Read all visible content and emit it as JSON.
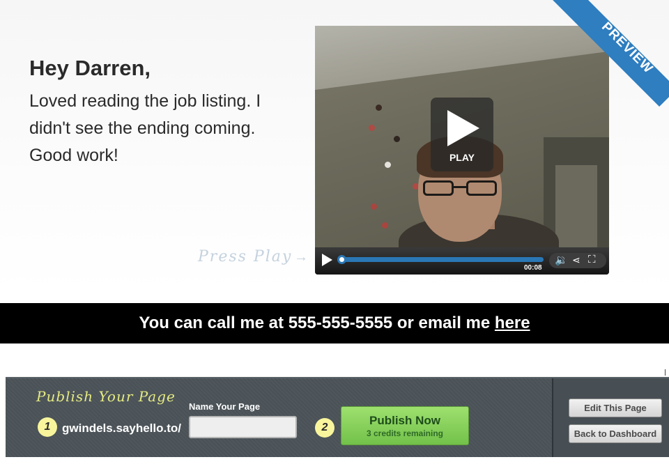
{
  "greeting": {
    "title": "Hey Darren,",
    "body": "Loved reading the job listing. I didn't see the ending coming. Good work!"
  },
  "press_play": {
    "label": "Press Play",
    "arrow": "→"
  },
  "video": {
    "play_label": "PLAY",
    "time": "00:08",
    "progress": 0.0
  },
  "ribbon": {
    "label": "PREVIEW"
  },
  "contact": {
    "text_before": "You can call me at 555-555-5555 or email me ",
    "link_text": "here"
  },
  "publish": {
    "heading": "Publish Your Page",
    "step1": "1",
    "domain": "gwindels.sayhello.to/",
    "name_label": "Name Your Page",
    "name_value": "",
    "step2": "2",
    "button_label": "Publish Now",
    "button_sub": "3 credits remaining"
  },
  "side_actions": {
    "edit_label": "Edit This Page",
    "back_label": "Back to Dashboard"
  },
  "colors": {
    "accent_blue": "#2e7ec0",
    "publish_green": "#72c14a",
    "badge_yellow": "#f8f59d",
    "heading_yellow": "#e6ea83",
    "panel_gray": "#4c5459"
  }
}
